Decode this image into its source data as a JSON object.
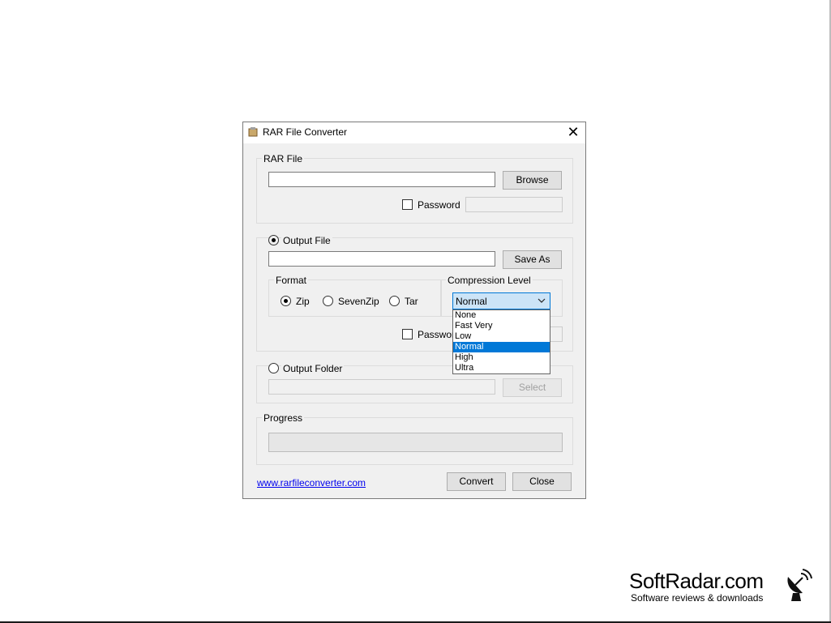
{
  "window": {
    "title": "RAR File Converter",
    "close_glyph": "✕"
  },
  "rar_file": {
    "group_label": "RAR File",
    "path_value": "",
    "browse_label": "Browse",
    "password_label": "Password",
    "password_checked": false,
    "password_value": ""
  },
  "output_file": {
    "label": "Output File",
    "selected": true,
    "path_value": "",
    "save_as_label": "Save As",
    "format": {
      "group_label": "Format",
      "options": [
        "Zip",
        "SevenZip",
        "Tar"
      ],
      "selected": "Zip"
    },
    "compression": {
      "group_label": "Compression Level",
      "selected": "Normal",
      "options": [
        "None",
        "Fast Very",
        "Low",
        "Normal",
        "High",
        "Ultra"
      ]
    },
    "password_label": "Password",
    "password_checked": false
  },
  "output_folder": {
    "label": "Output Folder",
    "selected": false,
    "path_value": "",
    "select_label": "Select"
  },
  "progress": {
    "group_label": "Progress",
    "value": 0
  },
  "footer": {
    "link_text": "www.rarfileconverter.com",
    "convert_label": "Convert",
    "close_label": "Close"
  },
  "watermark": {
    "name": "SoftRadar.com",
    "tagline": "Software reviews & downloads"
  },
  "icons": [
    "app-icon",
    "close-icon",
    "chevron-down-icon",
    "radar-dish-icon"
  ]
}
